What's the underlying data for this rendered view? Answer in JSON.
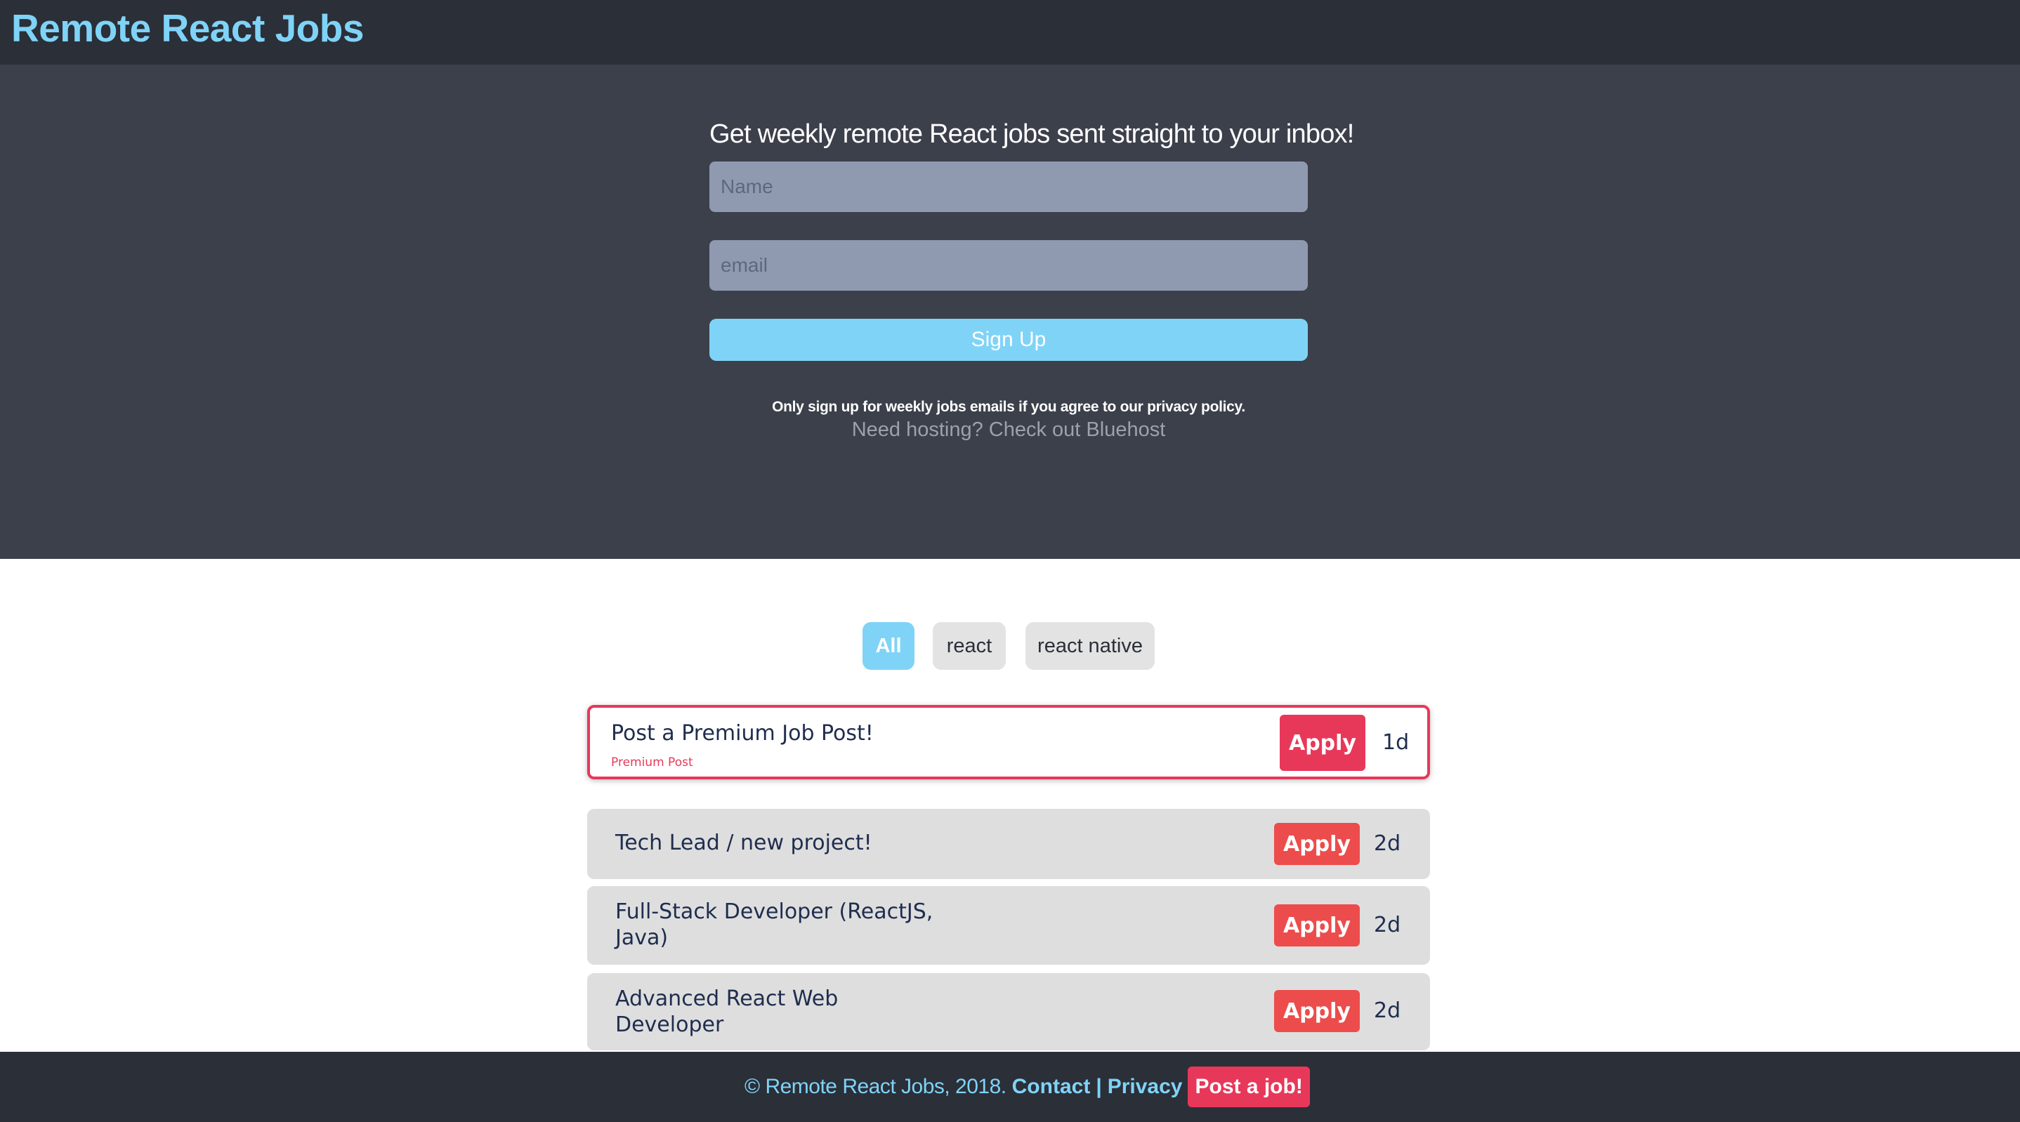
{
  "header": {
    "brand": "Remote React Jobs"
  },
  "signup": {
    "heading": "Get weekly remote React jobs sent straight to your inbox!",
    "name_placeholder": "Name",
    "email_placeholder": "email",
    "button_label": "Sign Up",
    "privacy_note": "Only sign up for weekly jobs emails if you agree to our privacy policy.",
    "hosting_link": "Need hosting? Check out Bluehost"
  },
  "filters": [
    {
      "label": "All",
      "active": true
    },
    {
      "label": "react",
      "active": false
    },
    {
      "label": "react native",
      "active": false
    }
  ],
  "jobs": [
    {
      "title": "Post a Premium Job Post!",
      "tag": "Premium Post",
      "apply_label": "Apply",
      "age": "1d",
      "premium": true
    },
    {
      "title": "Tech Lead / new project!",
      "apply_label": "Apply",
      "age": "2d",
      "premium": false
    },
    {
      "title": "Full-Stack Developer (ReactJS, Java)",
      "apply_label": "Apply",
      "age": "2d",
      "premium": false
    },
    {
      "title": "Advanced React Web Developer",
      "apply_label": "Apply",
      "age": "2d",
      "premium": false
    }
  ],
  "footer": {
    "copyright": "© Remote React Jobs, 2018.",
    "contact_label": "Contact",
    "separator": "|",
    "privacy_label": "Privacy",
    "post_job_label": "Post a job!"
  },
  "colors": {
    "accent": "#7fd3f7",
    "premium": "#e8385a",
    "apply": "#ed4c4c",
    "header_bg": "#2b2f38",
    "hero_bg": "#3c404b"
  },
  "icons": []
}
